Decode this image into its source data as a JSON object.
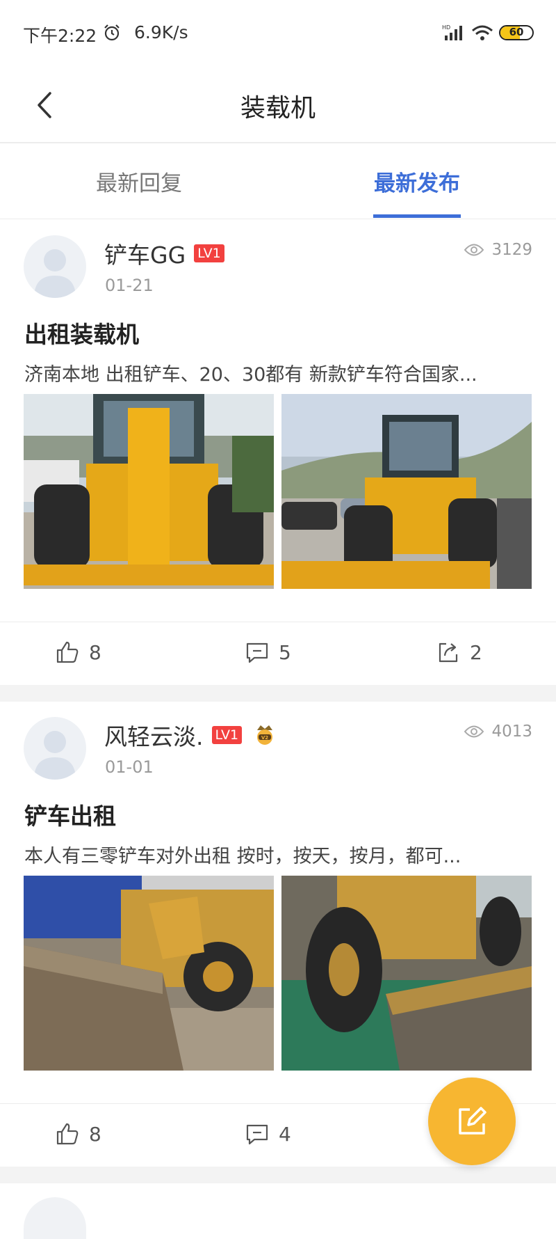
{
  "status_bar": {
    "time": "下午2:22",
    "network_speed": "6.9K/s",
    "battery_level": "60",
    "battery_fill_fraction": 0.6,
    "icons": [
      "alarm-icon",
      "signal-icon",
      "wifi-icon",
      "battery-icon"
    ]
  },
  "nav": {
    "title": "装载机",
    "back_icon": "chevron-left-icon"
  },
  "tabs": [
    {
      "label": "最新回复",
      "active": false
    },
    {
      "label": "最新发布",
      "active": true
    }
  ],
  "colors": {
    "accent": "#3d6ed8",
    "level_badge": "#f2413f",
    "fab": "#f7b631"
  },
  "posts": [
    {
      "author": "铲车GG",
      "level": "LV1",
      "date": "01-21",
      "views": "3129",
      "title": "出租装载机",
      "excerpt": "济南本地 出租铲车、20、30都有 新款铲车符合国家...",
      "likes": "8",
      "comments": "5",
      "shares": "2"
    },
    {
      "author": "风轻云淡.",
      "level": "LV1",
      "badge_icon": "v2-badge-icon",
      "date": "01-01",
      "views": "4013",
      "title": "铲车出租",
      "excerpt": "本人有三零铲车对外出租 按时，按天，按月，都可...",
      "likes": "8",
      "comments": "4",
      "shares": ""
    }
  ],
  "fab": {
    "icon": "edit-icon"
  }
}
